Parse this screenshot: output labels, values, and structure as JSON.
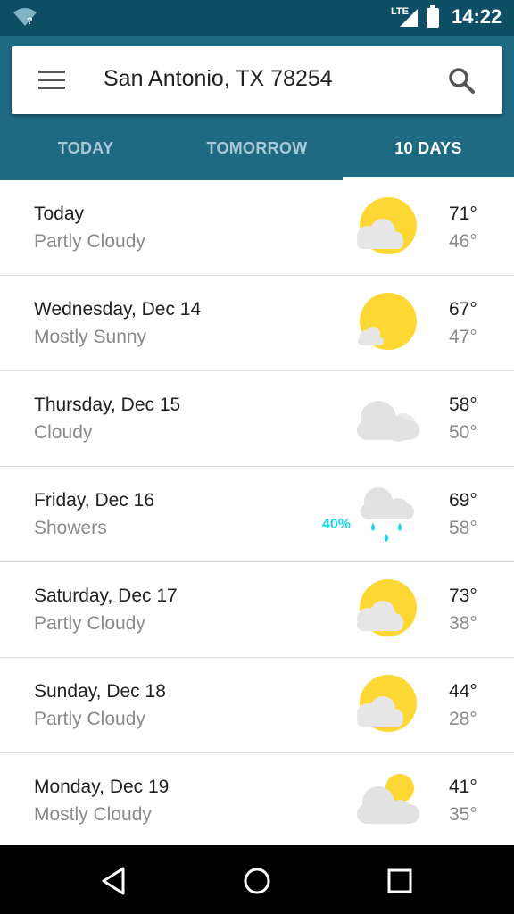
{
  "status_bar": {
    "time": "14:22",
    "network": "LTE",
    "icons": [
      "wifi-question-icon",
      "signal-icon",
      "battery-icon"
    ]
  },
  "search": {
    "location": "San Antonio, TX 78254",
    "menu_icon": "hamburger-menu-icon",
    "search_icon": "search-icon"
  },
  "tabs": [
    {
      "label": "TODAY"
    },
    {
      "label": "TOMORROW"
    },
    {
      "label": "10 DAYS"
    }
  ],
  "active_tab": "10 DAYS",
  "forecast": [
    {
      "day": "Today",
      "condition": "Partly Cloudy",
      "high": "71°",
      "low": "46°",
      "icon": "partly-cloudy-icon"
    },
    {
      "day": "Wednesday, Dec 14",
      "condition": "Mostly Sunny",
      "high": "67°",
      "low": "47°",
      "icon": "mostly-sunny-icon"
    },
    {
      "day": "Thursday, Dec 15",
      "condition": "Cloudy",
      "high": "58°",
      "low": "50°",
      "icon": "cloudy-icon"
    },
    {
      "day": "Friday, Dec 16",
      "condition": "Showers",
      "high": "69°",
      "low": "58°",
      "icon": "showers-icon",
      "precip": "40%"
    },
    {
      "day": "Saturday, Dec 17",
      "condition": "Partly Cloudy",
      "high": "73°",
      "low": "38°",
      "icon": "partly-cloudy-icon"
    },
    {
      "day": "Sunday, Dec 18",
      "condition": "Partly Cloudy",
      "high": "44°",
      "low": "28°",
      "icon": "partly-cloudy-icon"
    },
    {
      "day": "Monday, Dec 19",
      "condition": "Mostly Cloudy",
      "high": "41°",
      "low": "35°",
      "icon": "mostly-cloudy-icon"
    }
  ],
  "nav_bar": {
    "icons": [
      "back-icon",
      "home-icon",
      "recents-icon"
    ]
  },
  "colors": {
    "status_bar": "#0f4f66",
    "app_bar": "#1f6a83",
    "sun": "#fdd835",
    "cloud": "#e6e6e6",
    "precip_text": "#19d6f0"
  }
}
